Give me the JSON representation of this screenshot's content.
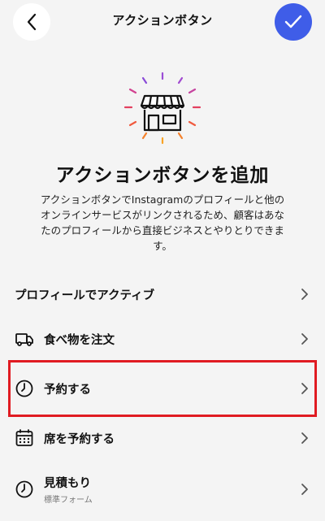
{
  "header": {
    "title": "アクションボタン",
    "back_icon": "chevron-left-icon",
    "done_icon": "checkmark-icon",
    "done_color": "#3f5de8"
  },
  "hero": {
    "icon": "storefront-icon",
    "title": "アクションボタンを追加",
    "description_lines": [
      "アクションボタンでInstagramのプロフィールと他の",
      "オンラインサービスがリンクされるため、顧客はあな",
      "たのプロフィールから直接ビジネスとやりとりできま",
      "す。"
    ]
  },
  "options": [
    {
      "label": "プロフィールでアクティブ",
      "icon": ""
    },
    {
      "label": "食べ物を注文",
      "icon": "delivery-truck-icon"
    },
    {
      "label": "予約する",
      "icon": "clock-icon",
      "highlighted": true
    },
    {
      "label": "席を予約する",
      "icon": "calendar-icon"
    },
    {
      "label": "見積もり",
      "sublabel": "標準フォーム",
      "icon": "clock-icon"
    }
  ],
  "highlight_color": "#e01b22"
}
